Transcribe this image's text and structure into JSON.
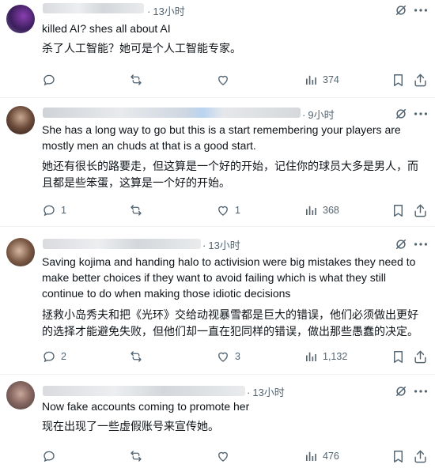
{
  "posts": [
    {
      "time": "13小时",
      "text_en": "killed AI? shes all about AI",
      "text_zh": "杀了人工智能？她可是个人工智能专家。",
      "reply_count": "",
      "repost_count": "",
      "like_count": "",
      "view_count": "374"
    },
    {
      "time": "9小时",
      "text_en": "She has a long way to go but this is a start remembering your players are mostly men an chuds at that is a good start.",
      "text_zh": "她还有很长的路要走，但这算是一个好的开始，记住你的球员大多是男人，而且都是些笨蛋，这算是一个好的开始。",
      "reply_count": "1",
      "repost_count": "",
      "like_count": "1",
      "view_count": "368"
    },
    {
      "time": "13小时",
      "text_en": "Saving kojima and handing halo to activision were big mistakes they need to make better choices if they want to avoid failing which is what they still continue to do when making those idiotic decisions",
      "text_zh": "拯救小岛秀夫和把《光环》交给动视暴雪都是巨大的错误，他们必须做出更好的选择才能避免失败，但他们却一直在犯同样的错误，做出那些愚蠢的决定。",
      "reply_count": "2",
      "repost_count": "",
      "like_count": "3",
      "view_count": "1,132"
    },
    {
      "time": "13小时",
      "text_en": "Now fake accounts coming to promote her",
      "text_zh": "现在出现了一些虚假账号来宣传她。",
      "reply_count": "",
      "repost_count": "",
      "like_count": "",
      "view_count": "476"
    }
  ],
  "colors": {
    "text_primary": "#0f1419",
    "text_secondary": "#536471",
    "divider": "#eff3f4"
  },
  "icons": [
    "reply-icon",
    "repost-icon",
    "like-icon",
    "views-icon",
    "bookmark-icon",
    "share-icon",
    "grok-icon",
    "more-icon"
  ]
}
